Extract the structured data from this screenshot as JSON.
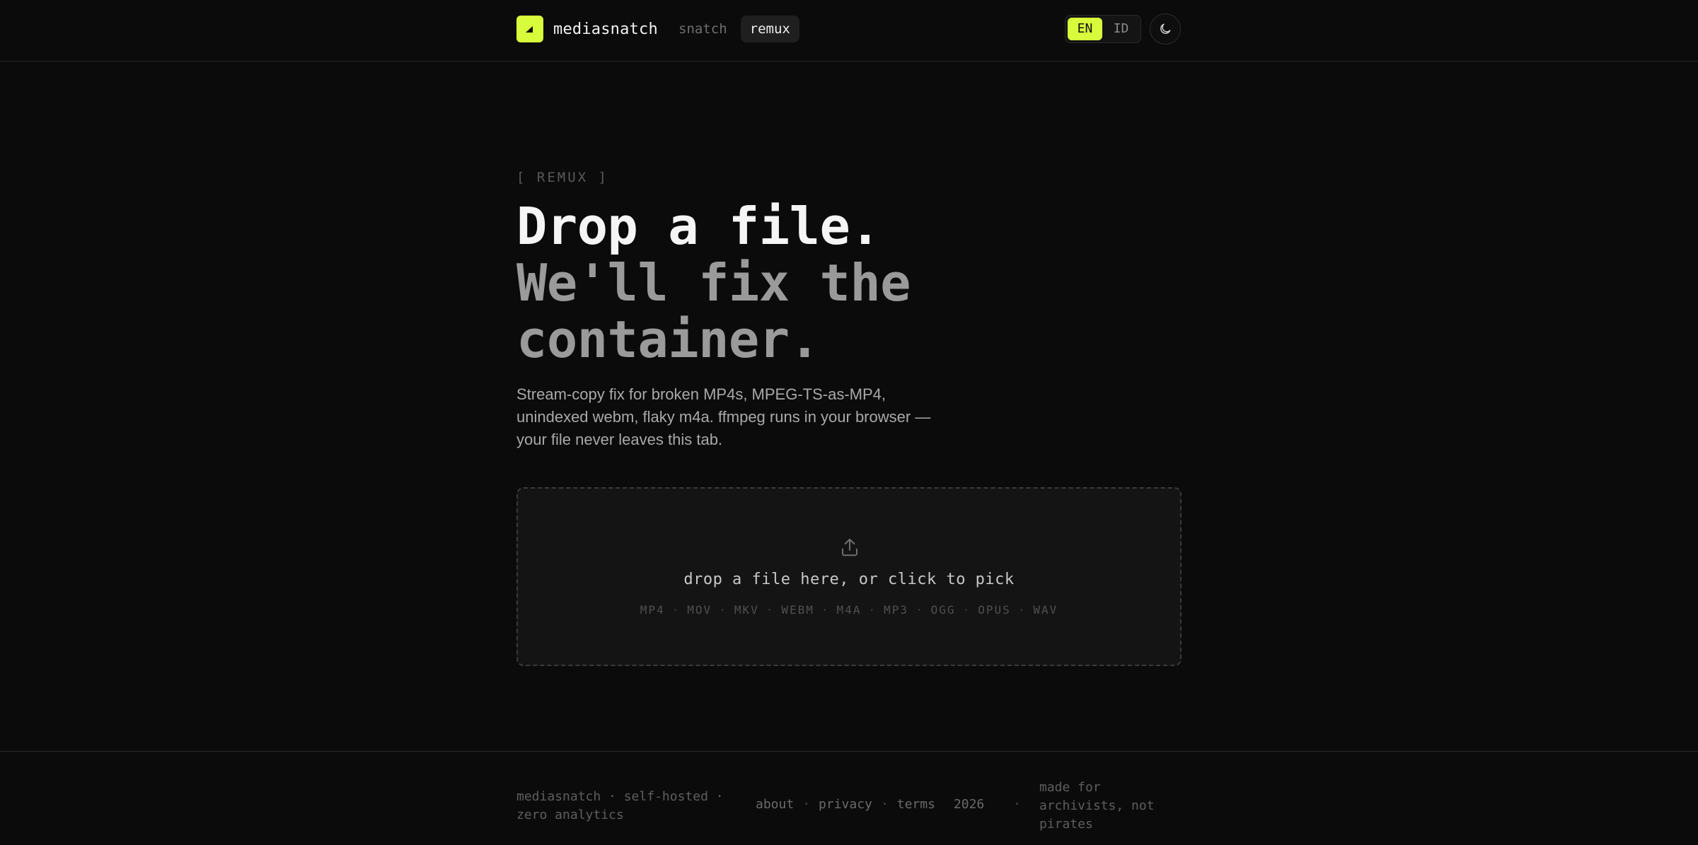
{
  "header": {
    "brand": "mediasnatch",
    "nav": [
      {
        "label": "snatch",
        "active": false
      },
      {
        "label": "remux",
        "active": true
      }
    ],
    "languages": [
      {
        "label": "EN",
        "active": true
      },
      {
        "label": "ID",
        "active": false
      }
    ],
    "theme_icon": "moon-icon"
  },
  "hero": {
    "eyebrow": "[ REMUX ]",
    "headline_line1": "Drop a file.",
    "headline_line2": "We'll fix the",
    "headline_line3": "container.",
    "lede": "Stream-copy fix for broken MP4s, MPEG-TS-as-MP4, unindexed webm, flaky m4a. ffmpeg runs in your browser — your file never leaves this tab."
  },
  "dropzone": {
    "icon": "upload-icon",
    "title": "drop a file here, or click to pick",
    "formats": [
      "MP4",
      "MOV",
      "MKV",
      "WEBM",
      "M4A",
      "MP3",
      "OGG",
      "OPUS",
      "WAV"
    ]
  },
  "footer": {
    "left_line1": "mediasnatch · self-hosted ·",
    "left_line2": "zero analytics",
    "links": [
      "about",
      "privacy",
      "terms"
    ],
    "year": "2026",
    "tagline": "made for archivists, not pirates"
  },
  "colors": {
    "accent": "#d8fb3b",
    "background": "#0b0b0b",
    "surface": "#141414"
  }
}
